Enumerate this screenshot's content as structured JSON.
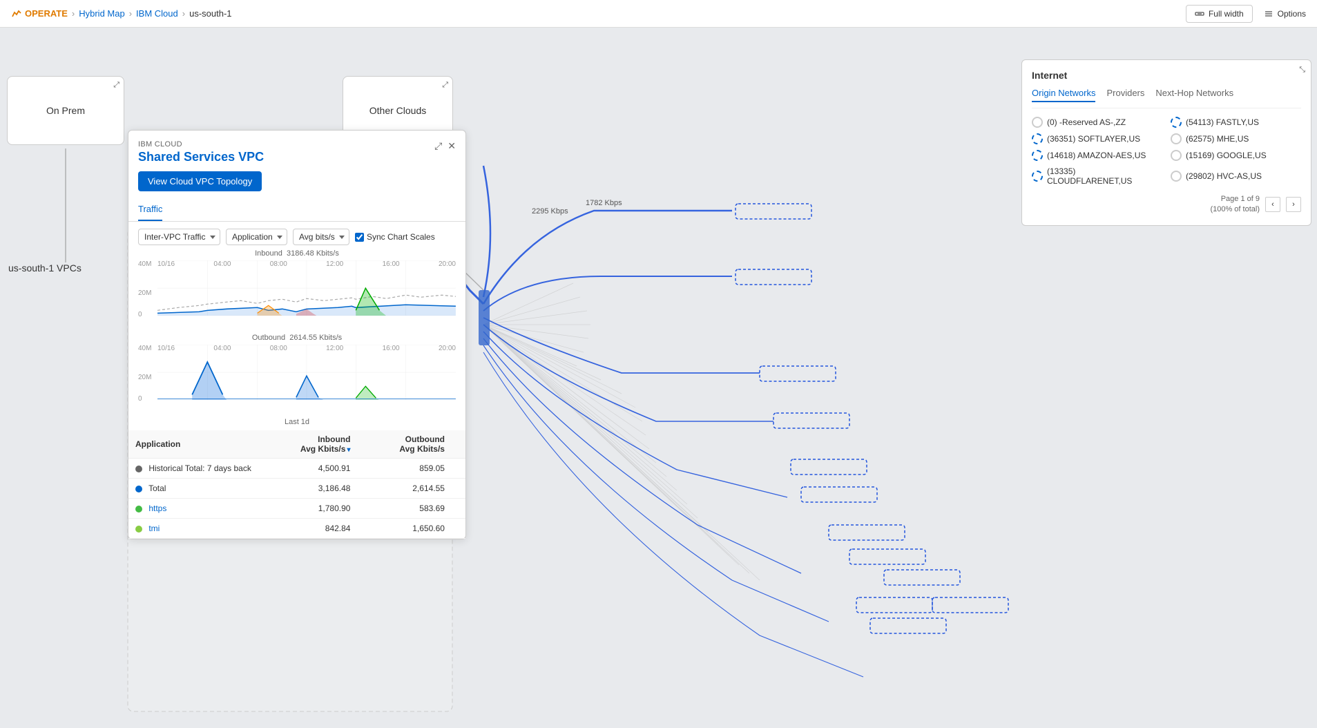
{
  "nav": {
    "logo": "OPERATE",
    "breadcrumb": [
      "Hybrid Map",
      "IBM Cloud",
      "us-south-1"
    ],
    "fullwidth_label": "Full width",
    "options_label": "Options"
  },
  "main": {
    "on_prem_label": "On Prem",
    "other_clouds_label": "Other Clouds",
    "region_label": "us-south-1",
    "region_suffix": " VPCs"
  },
  "internet_panel": {
    "title": "Internet",
    "tabs": [
      {
        "label": "Origin Networks",
        "active": true
      },
      {
        "label": "Providers",
        "active": false
      },
      {
        "label": "Next-Hop Networks",
        "active": false
      }
    ],
    "origins_col1": [
      {
        "label": "(0) -Reserved AS-,ZZ",
        "type": "solid-light"
      },
      {
        "label": "(36351) SOFTLAYER,US",
        "type": "dashed"
      },
      {
        "label": "(14618) AMAZON-AES,US",
        "type": "dashed"
      },
      {
        "label": "(13335) CLOUDFLARENET,US",
        "type": "dashed"
      }
    ],
    "origins_col2": [
      {
        "label": "(54113) FASTLY,US",
        "type": "dashed"
      },
      {
        "label": "(62575) MHE,US",
        "type": "solid-light"
      },
      {
        "label": "(15169) GOOGLE,US",
        "type": "solid-light"
      },
      {
        "label": "(29802) HVC-AS,US",
        "type": "solid-light"
      }
    ],
    "pagination": "Page 1 of 9\n(100% of total)"
  },
  "vpc_panel": {
    "ibm_cloud_label": "IBM CLOUD",
    "title": "Shared Services VPC",
    "view_button": "View Cloud VPC Topology",
    "tab": "Traffic",
    "controls": {
      "traffic_type": "Inter-VPC Traffic",
      "groupby": "Application",
      "metric": "Avg bits/s",
      "sync_label": "Sync Chart Scales"
    },
    "inbound_label": "Inbound",
    "inbound_value": "3186.48 Kbits/s",
    "outbound_label": "Outbound",
    "outbound_value": "2614.55 Kbits/s",
    "xaxis_labels": [
      "10/16",
      "04:00",
      "08:00",
      "12:00",
      "16:00",
      "20:00"
    ],
    "time_range": "Last 1d",
    "y_labels_in": [
      "40M",
      "20M",
      "0"
    ],
    "y_labels_out": [
      "40M",
      "20M",
      "0"
    ],
    "table_headers": [
      "Application",
      "Inbound\nAvg Kbits/s",
      "Outbound\nAvg Kbits/s"
    ],
    "table_rows": [
      {
        "dot": "gray",
        "app": "Historical Total: 7 days back",
        "inbound": "4,500.91",
        "outbound": "859.05"
      },
      {
        "dot": "blue",
        "app": "Total",
        "inbound": "3,186.48",
        "outbound": "2,614.55"
      },
      {
        "dot": "green",
        "app": "https",
        "link": true,
        "inbound": "1,780.90",
        "outbound": "583.69"
      },
      {
        "dot": "ltgreen",
        "app": "tmi",
        "link": true,
        "inbound": "842.84",
        "outbound": "1,650.60"
      }
    ]
  },
  "speed_labels": {
    "label1": "2295 Kbps",
    "label2": "1782 Kbps"
  }
}
